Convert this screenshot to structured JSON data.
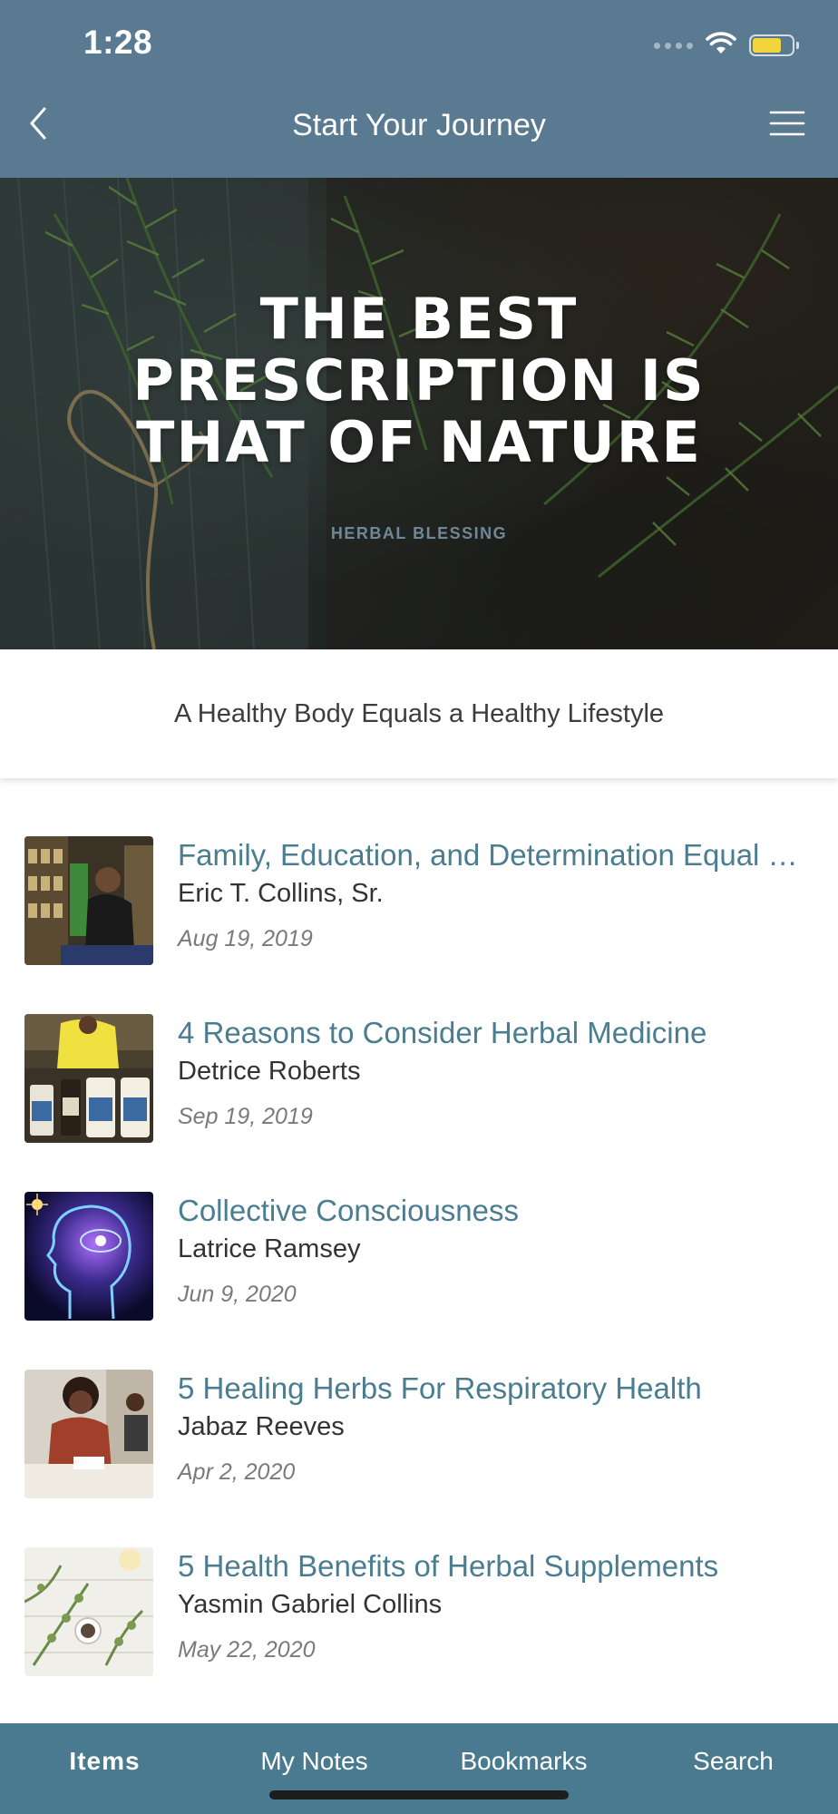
{
  "status_bar": {
    "time": "1:28",
    "battery_level": 0.75,
    "battery_color": "#f2d43b"
  },
  "nav": {
    "title": "Start Your Journey",
    "back_icon": "chevron-left-icon",
    "menu_icon": "hamburger-menu-icon",
    "background": "#5a7a92"
  },
  "hero": {
    "title_lines": [
      "THE BEST",
      "PRESCRIPTION IS",
      "THAT OF NATURE"
    ],
    "subtitle": "HERBAL BLESSING"
  },
  "tagline": "A Healthy Body Equals a Healthy Lifestyle",
  "articles": [
    {
      "title": "Family, Education, and Determination Equal Success",
      "author": "Eric T. Collins, Sr.",
      "date": "Aug 19, 2019",
      "thumbnail": "herb-shop-photo"
    },
    {
      "title": "4 Reasons to Consider Herbal Medicine",
      "author": "Detrice Roberts",
      "date": "Sep 19, 2019",
      "thumbnail": "herbal-bottles-photo"
    },
    {
      "title": "Collective Consciousness",
      "author": "Latrice Ramsey",
      "date": "Jun 9, 2020",
      "thumbnail": "glowing-head-illustration"
    },
    {
      "title": "5 Healing Herbs For Respiratory Health",
      "author": "Jabaz Reeves",
      "date": "Apr 2, 2020",
      "thumbnail": "woman-at-desk-photo"
    },
    {
      "title": "5 Health Benefits of Herbal Supplements",
      "author": "Yasmin Gabriel Collins",
      "date": "May 22, 2020",
      "thumbnail": "herbs-on-table-photo"
    }
  ],
  "tabs": [
    {
      "label": "Items",
      "active": true
    },
    {
      "label": "My Notes",
      "active": false
    },
    {
      "label": "Bookmarks",
      "active": false
    },
    {
      "label": "Search",
      "active": false
    }
  ],
  "colors": {
    "title_link": "#4a7d8f",
    "tab_bar": "#4a7a8f"
  }
}
